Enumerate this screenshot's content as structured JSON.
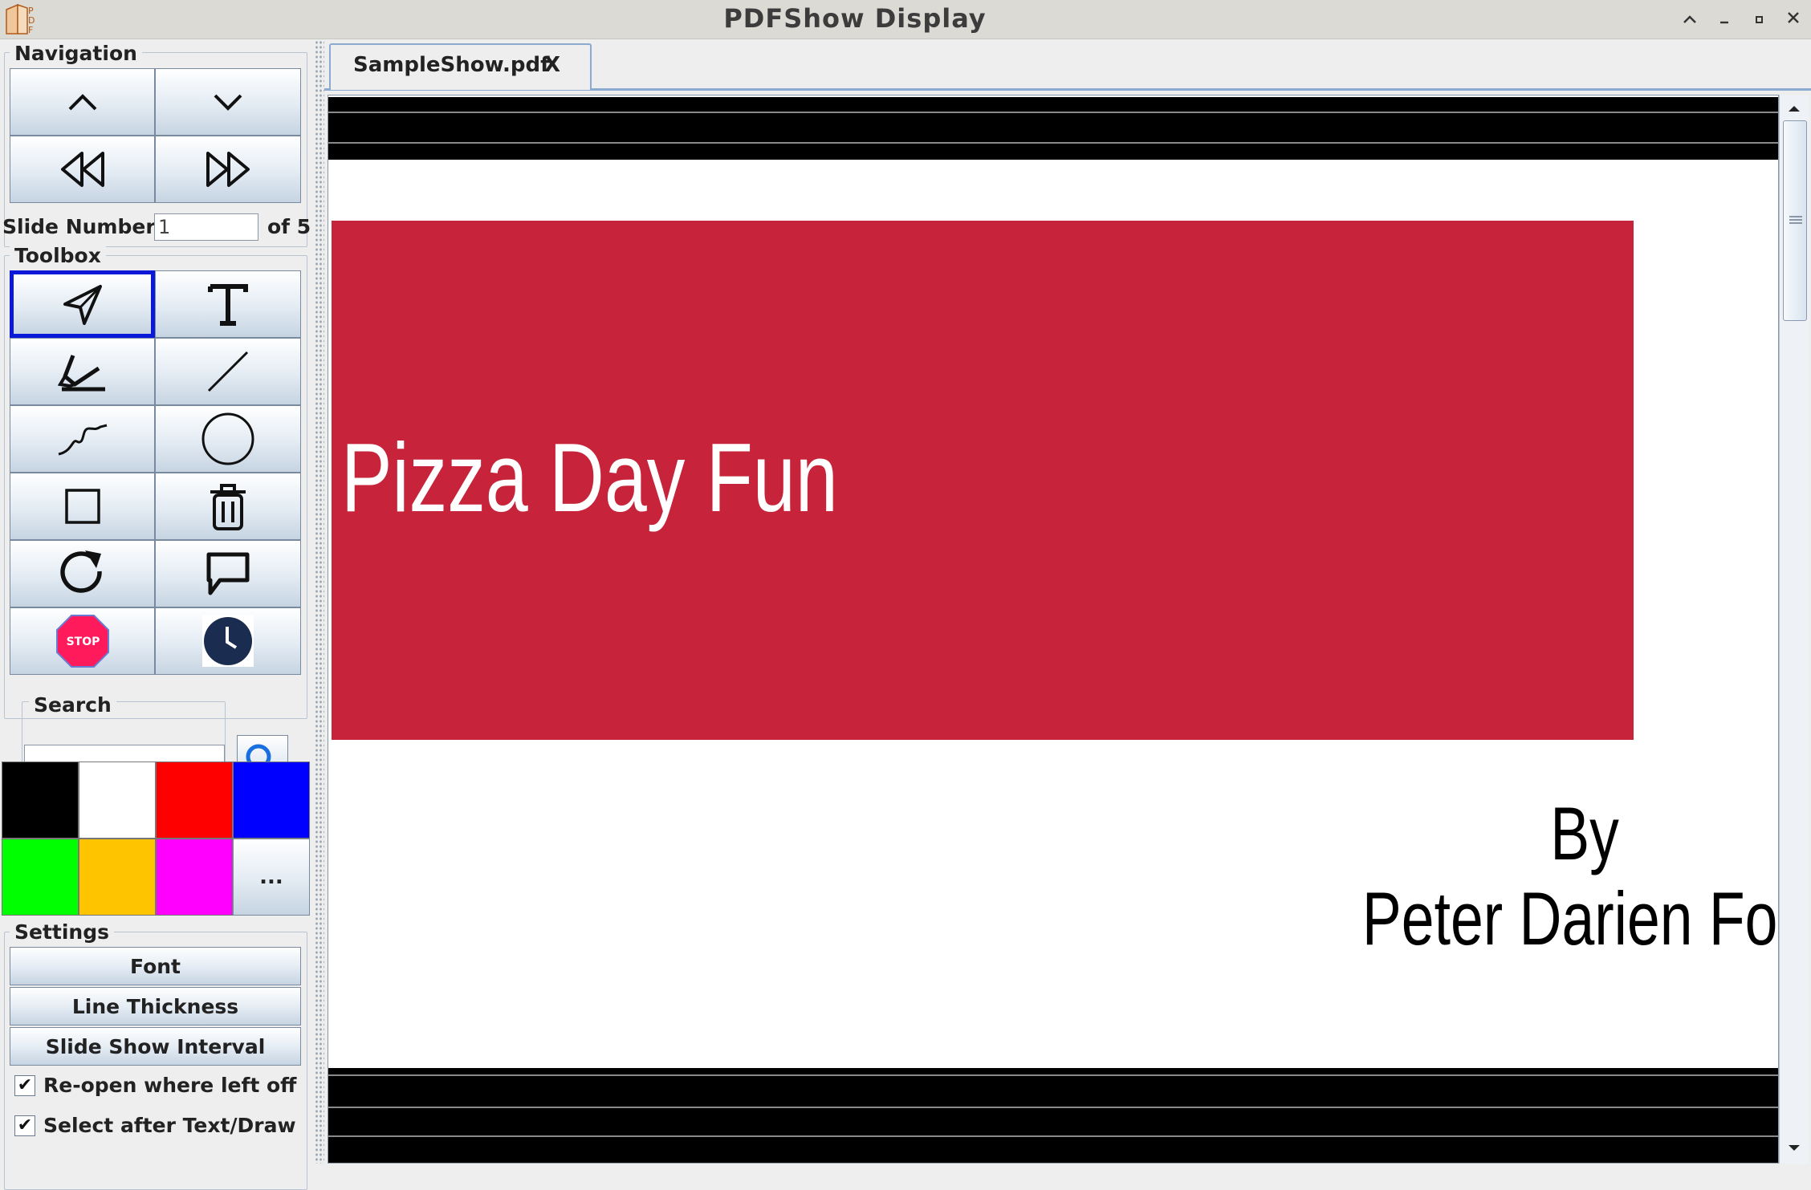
{
  "window": {
    "title": "PDFShow Display",
    "controls": [
      "restore",
      "minimize",
      "maximize",
      "close"
    ]
  },
  "navigation": {
    "title": "Navigation",
    "buttons": [
      "previous-slide",
      "next-slide",
      "first-slide",
      "last-slide"
    ],
    "slide_number_label": "Slide Number",
    "slide_number_value": "1",
    "slide_total": "of 5"
  },
  "toolbox": {
    "title": "Toolbox",
    "tools": [
      "select",
      "text",
      "highlighter",
      "line",
      "freehand",
      "circle",
      "rectangle",
      "delete",
      "refresh",
      "comment",
      "stop",
      "clock"
    ],
    "selected": "select",
    "stop_label": "STOP"
  },
  "search": {
    "label": "Search",
    "value": ""
  },
  "colors": {
    "swatches": [
      "#000000",
      "#ffffff",
      "#ff0000",
      "#0000ff",
      "#00ff00",
      "#ffc400",
      "#ff00ff"
    ],
    "more_label": "..."
  },
  "settings": {
    "title": "Settings",
    "font_label": "Font",
    "line_thickness_label": "Line Thickness",
    "interval_label": "Slide Show Interval",
    "reopen_label": "Re-open where left off",
    "reopen_checked": true,
    "select_after_label": "Select after Text/Draw",
    "select_after_checked": true
  },
  "tabs": [
    {
      "label": "SampleShow.pdf",
      "close": "X"
    }
  ],
  "slide": {
    "title": "Pizza Day Fun",
    "byline_1": "By",
    "byline_2": "Peter Darien Fox",
    "banner_color": "#c7233a"
  }
}
